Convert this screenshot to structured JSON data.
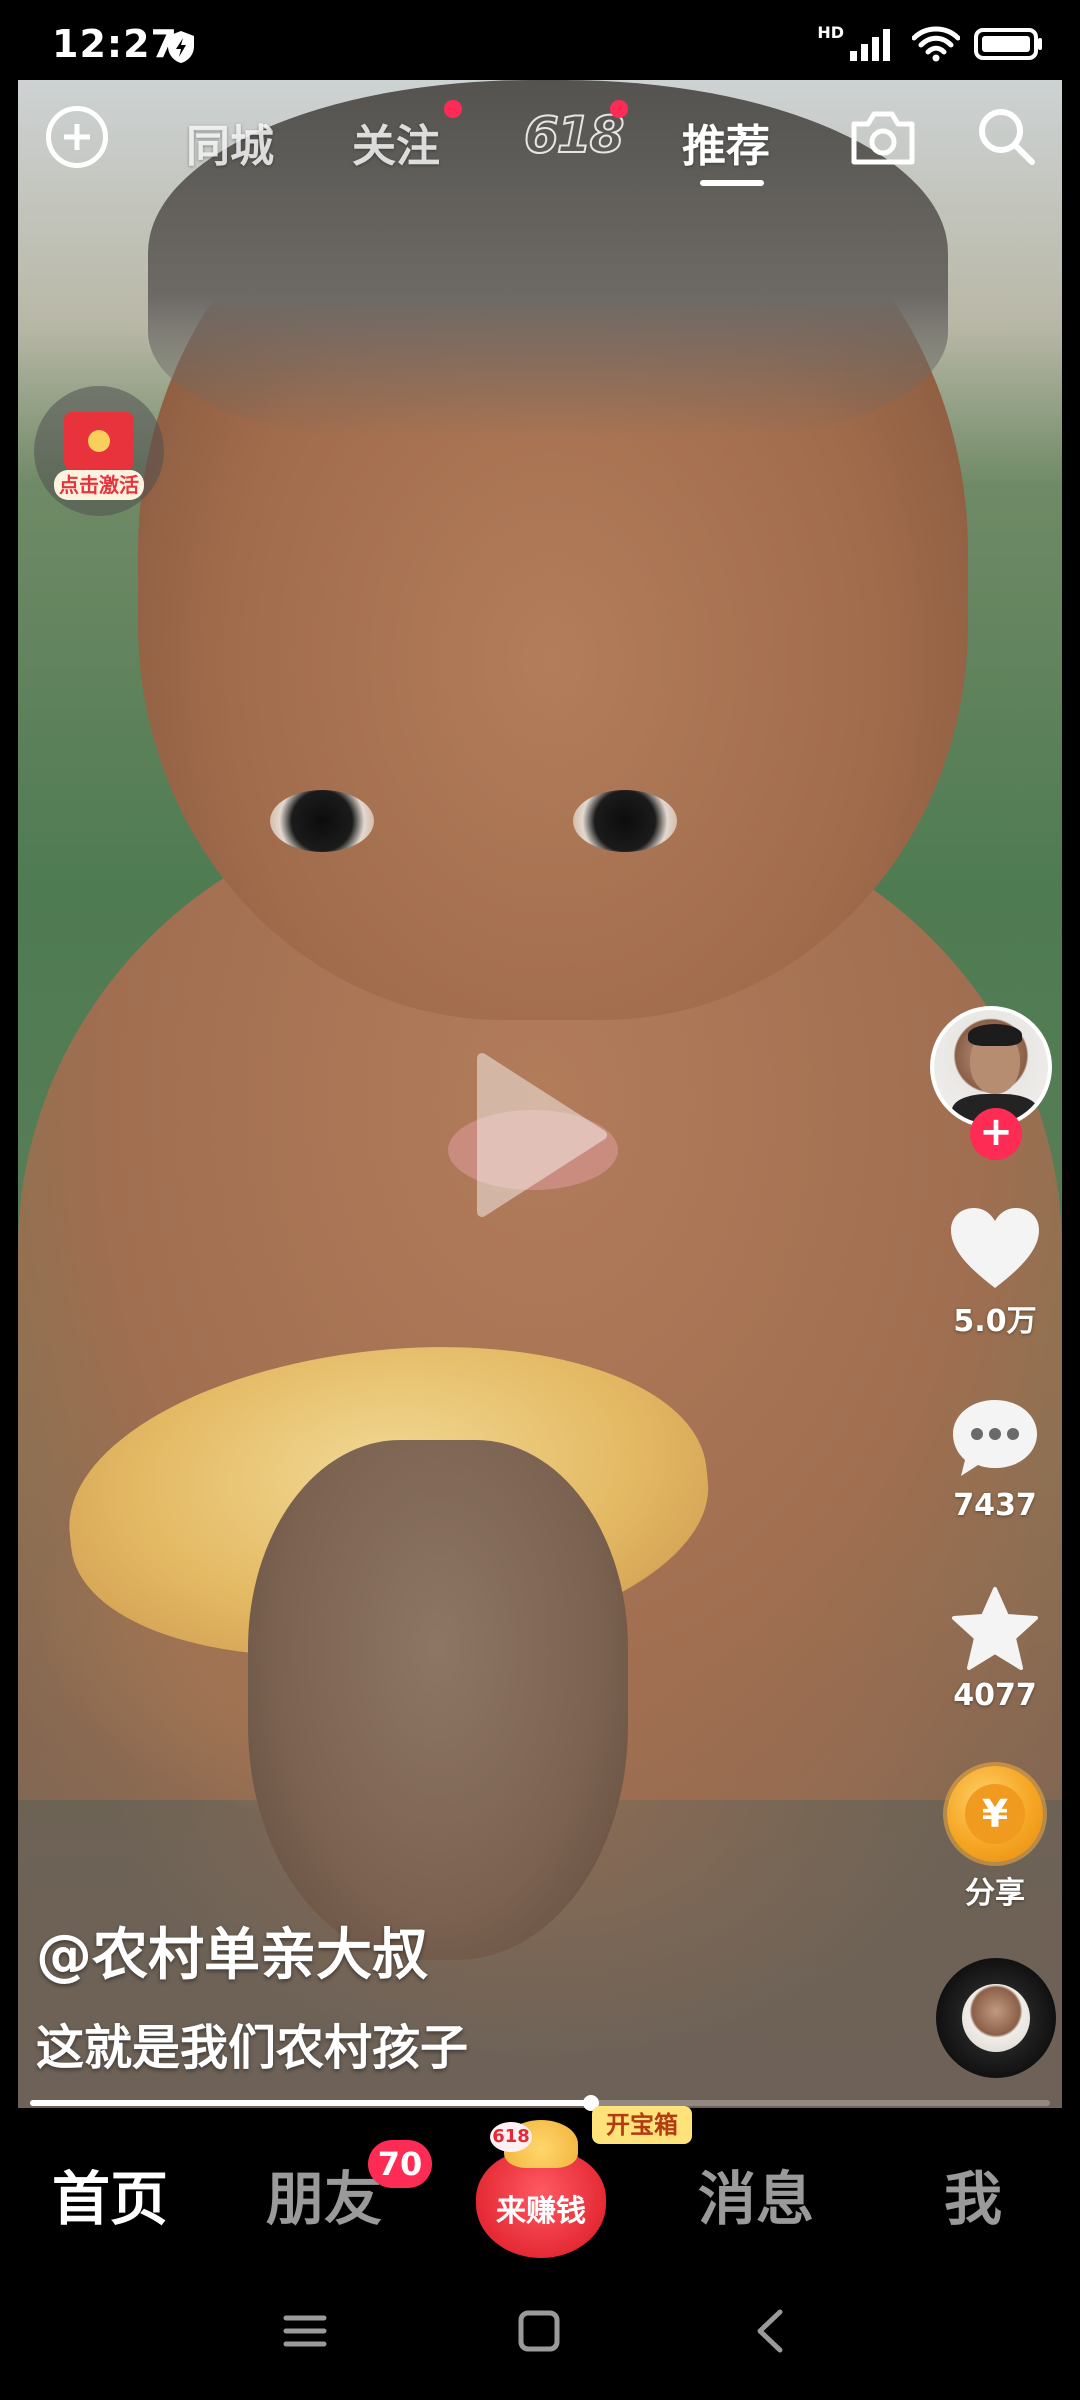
{
  "status_bar": {
    "time": "12:27",
    "network": "HD",
    "icons": [
      "shield-icon",
      "signal-icon",
      "wifi-icon",
      "battery-icon"
    ]
  },
  "top_nav": {
    "tabs": [
      {
        "label": "同城",
        "active": false,
        "dot": false
      },
      {
        "label": "关注",
        "active": false,
        "dot": true
      },
      {
        "label": "618",
        "active": false,
        "dot": true
      },
      {
        "label": "推荐",
        "active": true,
        "dot": false
      }
    ],
    "icons": [
      "plus-circle-icon",
      "camera-icon",
      "search-icon"
    ]
  },
  "red_packet": {
    "label": "点击激活"
  },
  "video": {
    "author": "@农村单亲大叔",
    "caption": "这就是我们农村孩子",
    "progress": 0.55
  },
  "actions": {
    "like_count": "5.0万",
    "comment_count": "7437",
    "favorite_count": "4077",
    "share_label": "分享",
    "coin_symbol": "¥"
  },
  "tab_bar": {
    "home": "首页",
    "friends": "朋友",
    "friends_badge": "70",
    "earn": "来赚钱",
    "earn_badge": "618",
    "treasure": "开宝箱",
    "messages": "消息",
    "me": "我"
  },
  "colors": {
    "accent": "#fe2c55",
    "coin": "#f5a623",
    "background": "#000000"
  }
}
